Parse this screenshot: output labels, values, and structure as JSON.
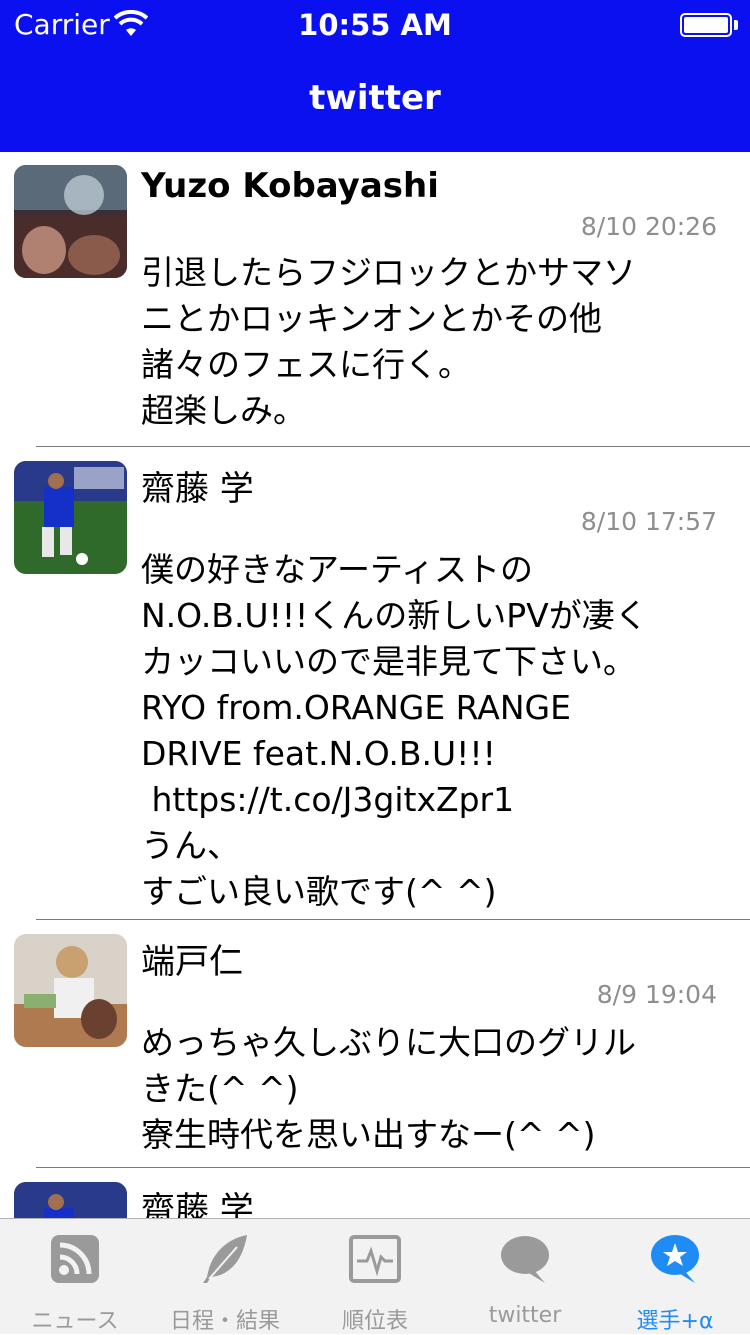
{
  "status_bar": {
    "carrier": "Carrier",
    "time": "10:55 AM"
  },
  "nav": {
    "title": "twitter"
  },
  "tweets": [
    {
      "name": "Yuzo Kobayashi",
      "time": "8/10 20:26",
      "lines": [
        "引退したらフジロックとかサマソ",
        "ニとかロッキンオンとかその他",
        "諸々のフェスに行く。",
        "超楽しみ。"
      ]
    },
    {
      "name": "齋藤 学",
      "time": "8/10 17:57",
      "lines": [
        "僕の好きなアーティストの",
        "N.O.B.U!!!くんの新しいPVが凄く",
        "カッコいいので是非見て下さい。",
        "RYO from.ORANGE RANGE",
        "DRIVE feat.N.O.B.U!!!",
        " https://t.co/J3gitxZpr1",
        "うん、",
        "すごい良い歌です(^ ^)"
      ]
    },
    {
      "name": "端戸仁",
      "time": "8/9 19:04",
      "lines": [
        "めっちゃ久しぶりに大口のグリル",
        "きた(^ ^)",
        "寮生時代を思い出すなー(^ ^)"
      ]
    },
    {
      "name": "齋藤 学"
    }
  ],
  "tabs": [
    {
      "label": "ニュース",
      "icon": "rss-icon"
    },
    {
      "label": "日程・結果",
      "icon": "feather-icon"
    },
    {
      "label": "順位表",
      "icon": "activity-monitor-icon"
    },
    {
      "label": "twitter",
      "icon": "speech-bubble-icon"
    },
    {
      "label": "選手+α",
      "icon": "star-bubble-icon"
    }
  ],
  "colors": {
    "nav_background": "#0a10f0",
    "tab_active": "#1f8cf5",
    "tab_inactive": "#9a9a9a",
    "timestamp": "#8e8e8e"
  }
}
